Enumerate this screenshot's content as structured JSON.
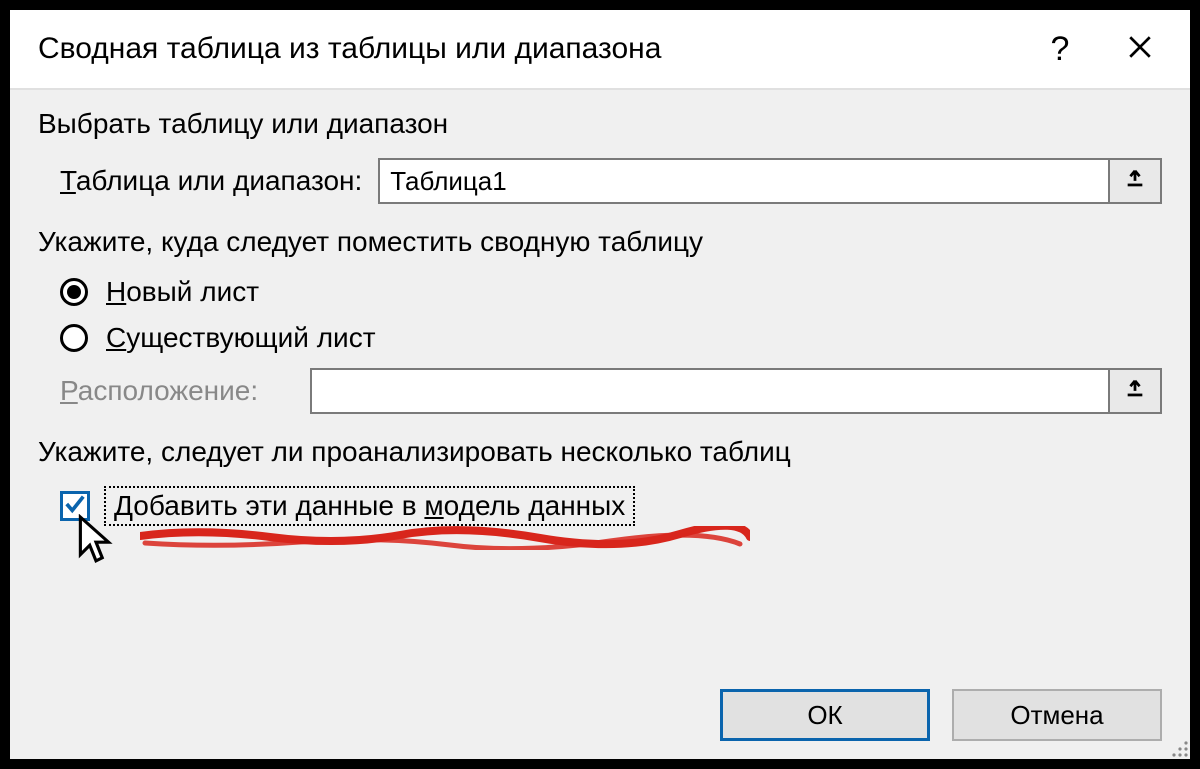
{
  "dialog": {
    "title": "Сводная таблица из таблицы или диапазона",
    "section1": {
      "heading": "Выбрать таблицу или диапазон",
      "table_label_pre": "Т",
      "table_label_rest": "аблица или диапазон:",
      "table_value": "Таблица1"
    },
    "section2": {
      "heading": "Укажите, куда следует поместить сводную таблицу",
      "radio_new_pre": "Н",
      "radio_new_rest": "овый лист",
      "radio_exist_pre": "С",
      "radio_exist_rest": "уществующий лист",
      "location_label_pre": "Р",
      "location_label_rest": "асположение:",
      "location_value": ""
    },
    "section3": {
      "heading": "Укажите, следует ли проанализировать несколько таблиц",
      "check_pre": "Добавить эти данные в ",
      "check_u": "м",
      "check_post": "одель данных"
    },
    "buttons": {
      "ok": "ОК",
      "cancel": "Отмена"
    }
  }
}
